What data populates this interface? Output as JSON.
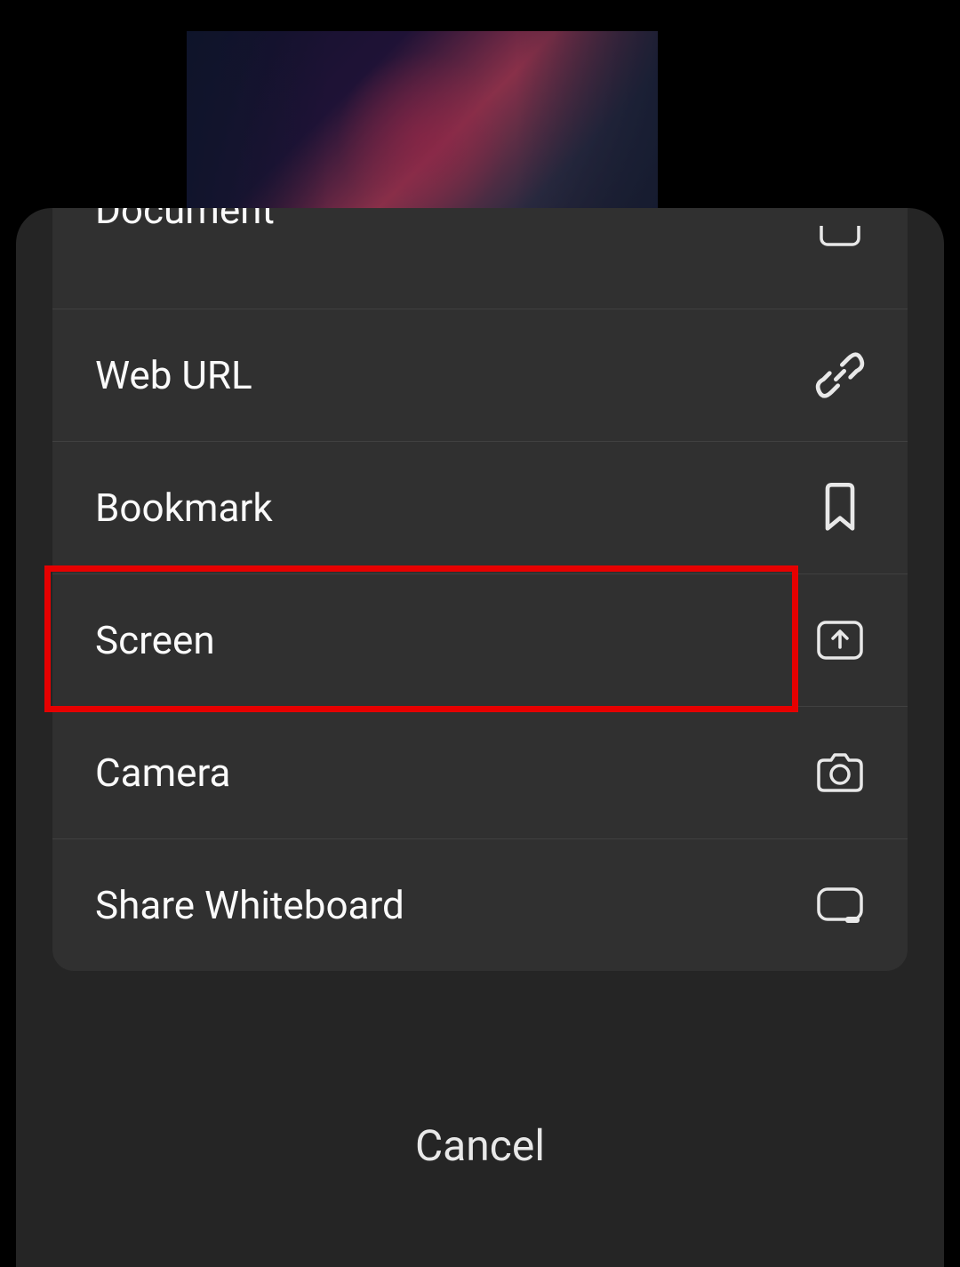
{
  "options": [
    {
      "label": "Document",
      "icon": "document"
    },
    {
      "label": "Web URL",
      "icon": "link"
    },
    {
      "label": "Bookmark",
      "icon": "bookmark"
    },
    {
      "label": "Screen",
      "icon": "screen-share"
    },
    {
      "label": "Camera",
      "icon": "camera"
    },
    {
      "label": "Share Whiteboard",
      "icon": "whiteboard"
    }
  ],
  "cancel_label": "Cancel",
  "highlighted_index": 3
}
